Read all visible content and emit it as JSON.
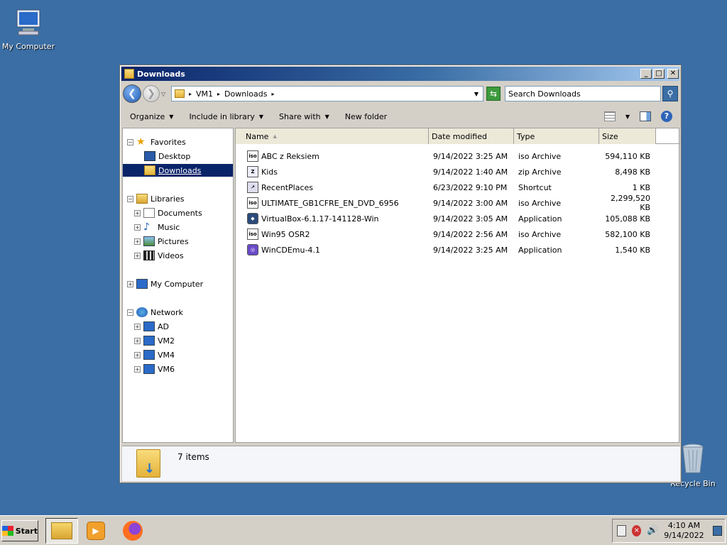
{
  "desktop": {
    "my_computer": "My Computer",
    "recycle_bin": "Recycle Bin"
  },
  "window": {
    "title": "Downloads",
    "min": "_",
    "max": "□",
    "close": "✕"
  },
  "address": {
    "crumbs": [
      "VM1",
      "Downloads"
    ],
    "search_placeholder": "Search Downloads"
  },
  "toolbar": {
    "organize": "Organize",
    "include_library": "Include in library",
    "share_with": "Share with",
    "new_folder": "New folder"
  },
  "nav": {
    "favorites": "Favorites",
    "desktop": "Desktop",
    "downloads": "Downloads",
    "libraries": "Libraries",
    "documents": "Documents",
    "music": "Music",
    "pictures": "Pictures",
    "videos": "Videos",
    "my_computer": "My Computer",
    "network": "Network",
    "ad": "AD",
    "vm2": "VM2",
    "vm4": "VM4",
    "vm6": "VM6"
  },
  "columns": {
    "name": "Name",
    "date": "Date modified",
    "type": "Type",
    "size": "Size"
  },
  "files": [
    {
      "name": "ABC z Reksiem",
      "date": "9/14/2022 3:25 AM",
      "type": "iso Archive",
      "size": "594,110 KB",
      "icon": "iso-icon"
    },
    {
      "name": "Kids",
      "date": "9/14/2022 1:40 AM",
      "type": "zip Archive",
      "size": "8,498 KB",
      "icon": "zip-icon"
    },
    {
      "name": "RecentPlaces",
      "date": "6/23/2022 9:10 PM",
      "type": "Shortcut",
      "size": "1 KB",
      "icon": "shortcut-icon"
    },
    {
      "name": "ULTIMATE_GB1CFRE_EN_DVD_6956",
      "date": "9/14/2022 3:00 AM",
      "type": "iso Archive",
      "size": "2,299,520 KB",
      "icon": "iso-icon"
    },
    {
      "name": "VirtualBox-6.1.17-141128-Win",
      "date": "9/14/2022 3:05 AM",
      "type": "Application",
      "size": "105,088 KB",
      "icon": "virtualbox-icon"
    },
    {
      "name": "Win95 OSR2",
      "date": "9/14/2022 2:56 AM",
      "type": "iso Archive",
      "size": "582,100 KB",
      "icon": "iso-icon"
    },
    {
      "name": "WinCDEmu-4.1",
      "date": "9/14/2022 3:25 AM",
      "type": "Application",
      "size": "1,540 KB",
      "icon": "wincdemu-icon"
    }
  ],
  "details": {
    "count": "7 items"
  },
  "taskbar": {
    "start": "Start",
    "time": "4:10 AM",
    "date": "9/14/2022"
  },
  "icon_text": {
    "iso": "iso",
    "zip": "Z",
    "back": "❮",
    "forward": "❯",
    "refresh": "⇆",
    "search": "⚲",
    "help": "?"
  },
  "colors": {
    "desktop": "#3a6ea5",
    "selection": "#0a246a"
  }
}
